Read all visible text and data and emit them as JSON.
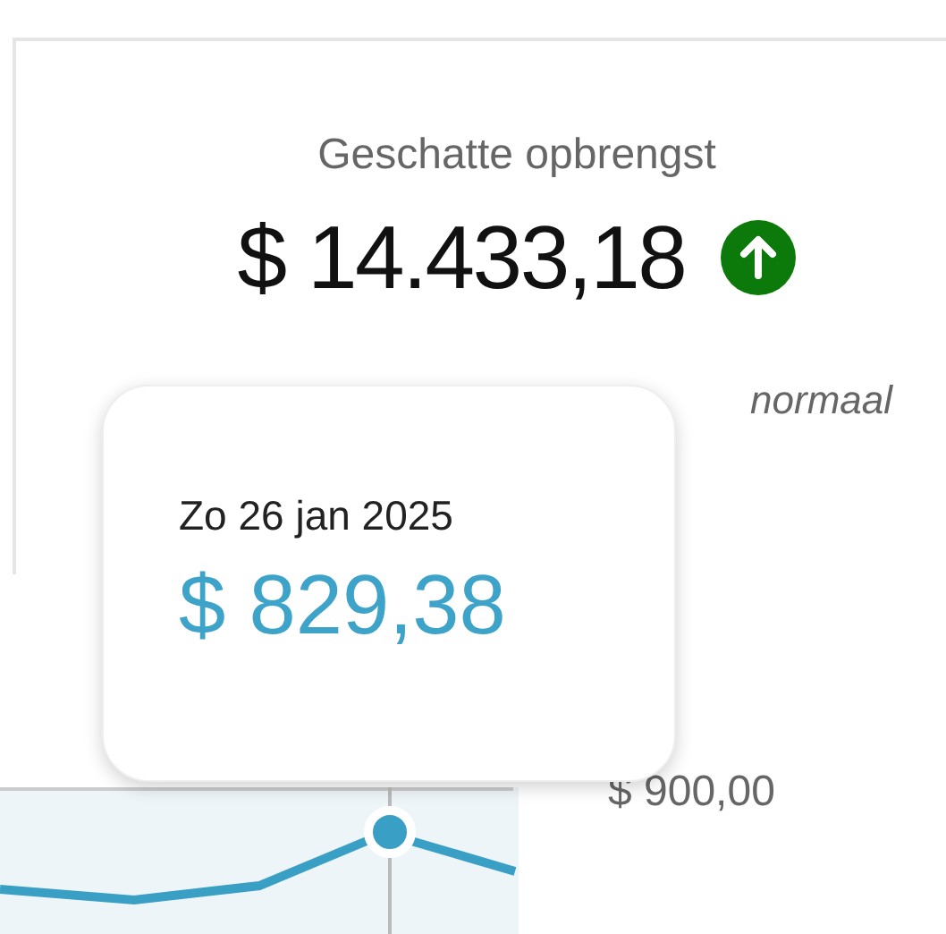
{
  "summary": {
    "title": "Geschatte opbrengst",
    "amount": "$ 14.433,18",
    "rising": true,
    "note": "normaal"
  },
  "chart": {
    "axis_label": "$ 900,00"
  },
  "tooltip": {
    "date": "Zo 26 jan 2025",
    "value": "$ 829,38"
  }
}
